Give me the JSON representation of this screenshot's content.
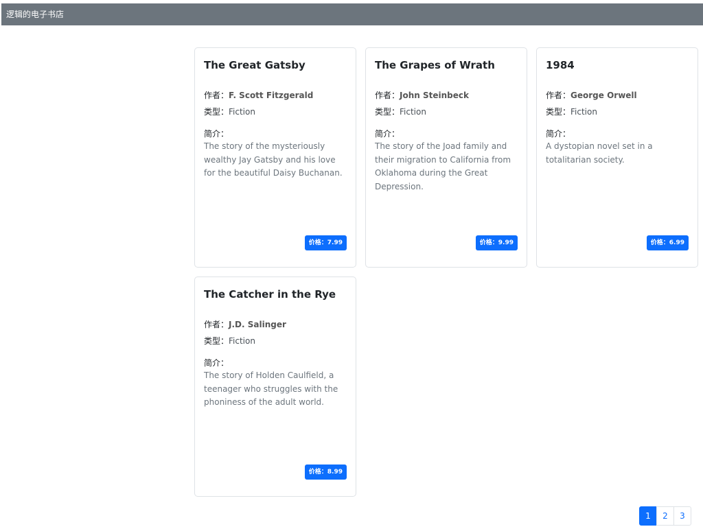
{
  "navbar": {
    "brand": "逻辑的电子书店"
  },
  "labels": {
    "author": "作者：",
    "genre": "类型：",
    "intro": "简介："
  },
  "books": [
    {
      "title": "The Great Gatsby",
      "author": "F. Scott Fitzgerald",
      "genre": "Fiction",
      "intro": "The story of the mysteriously wealthy Jay Gatsby and his love for the beautiful Daisy Buchanan.",
      "price": "价格：7.99"
    },
    {
      "title": "The Grapes of Wrath",
      "author": "John Steinbeck",
      "genre": "Fiction",
      "intro": "The story of the Joad family and their migration to California from Oklahoma during the Great Depression.",
      "price": "价格：9.99"
    },
    {
      "title": "1984",
      "author": "George Orwell",
      "genre": "Fiction",
      "intro": "A dystopian novel set in a totalitarian society.",
      "price": "价格：6.99"
    },
    {
      "title": "The Catcher in the Rye",
      "author": "J.D. Salinger",
      "genre": "Fiction",
      "intro": "The story of Holden Caulfield, a teenager who struggles with the phoniness of the adult world.",
      "price": "价格：8.99"
    }
  ],
  "pagination": {
    "pages": [
      "1",
      "2",
      "3"
    ],
    "current": "1"
  },
  "colors": {
    "navbar": "#6c757d",
    "primary": "#0d6efd"
  }
}
